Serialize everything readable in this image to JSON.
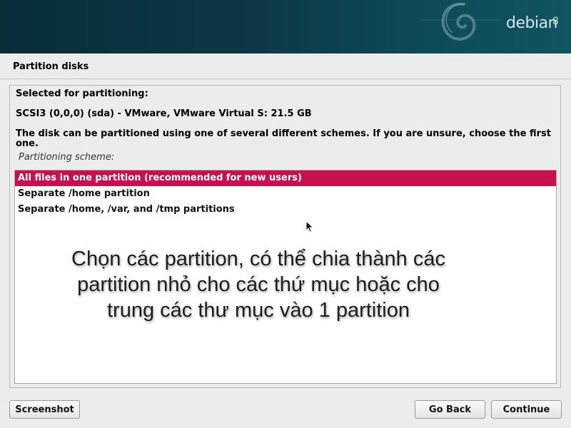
{
  "banner": {
    "logo_text": "debian",
    "logo_version": "8",
    "background_color": "#0b3846",
    "swirl_icon": "debian-swirl-icon"
  },
  "page": {
    "title": "Partition disks"
  },
  "content": {
    "selected_label": "Selected for partitioning:",
    "disk": "SCSI3 (0,0,0) (sda) - VMware, VMware Virtual S: 21.5 GB",
    "description_line1": "The disk can be partitioned using one of several different schemes. If you are unsure, choose the first",
    "description_line2": "one.",
    "scheme_label": "Partitioning scheme:"
  },
  "scheme_list": {
    "items": [
      {
        "label": "All files in one partition (recommended for new users)",
        "selected": true
      },
      {
        "label": "Separate /home partition",
        "selected": false
      },
      {
        "label": "Separate /home, /var, and /tmp partitions",
        "selected": false
      }
    ],
    "selected_color": "#c5114f"
  },
  "overlay": {
    "line1": "Chọn các partition, có thể chia thành các",
    "line2": "partition nhỏ cho các thứ mục hoặc cho",
    "line3": "trung các thư mục vào 1 partition"
  },
  "buttons": {
    "screenshot": "Screenshot",
    "go_back": "Go Back",
    "continue": "Continue"
  }
}
